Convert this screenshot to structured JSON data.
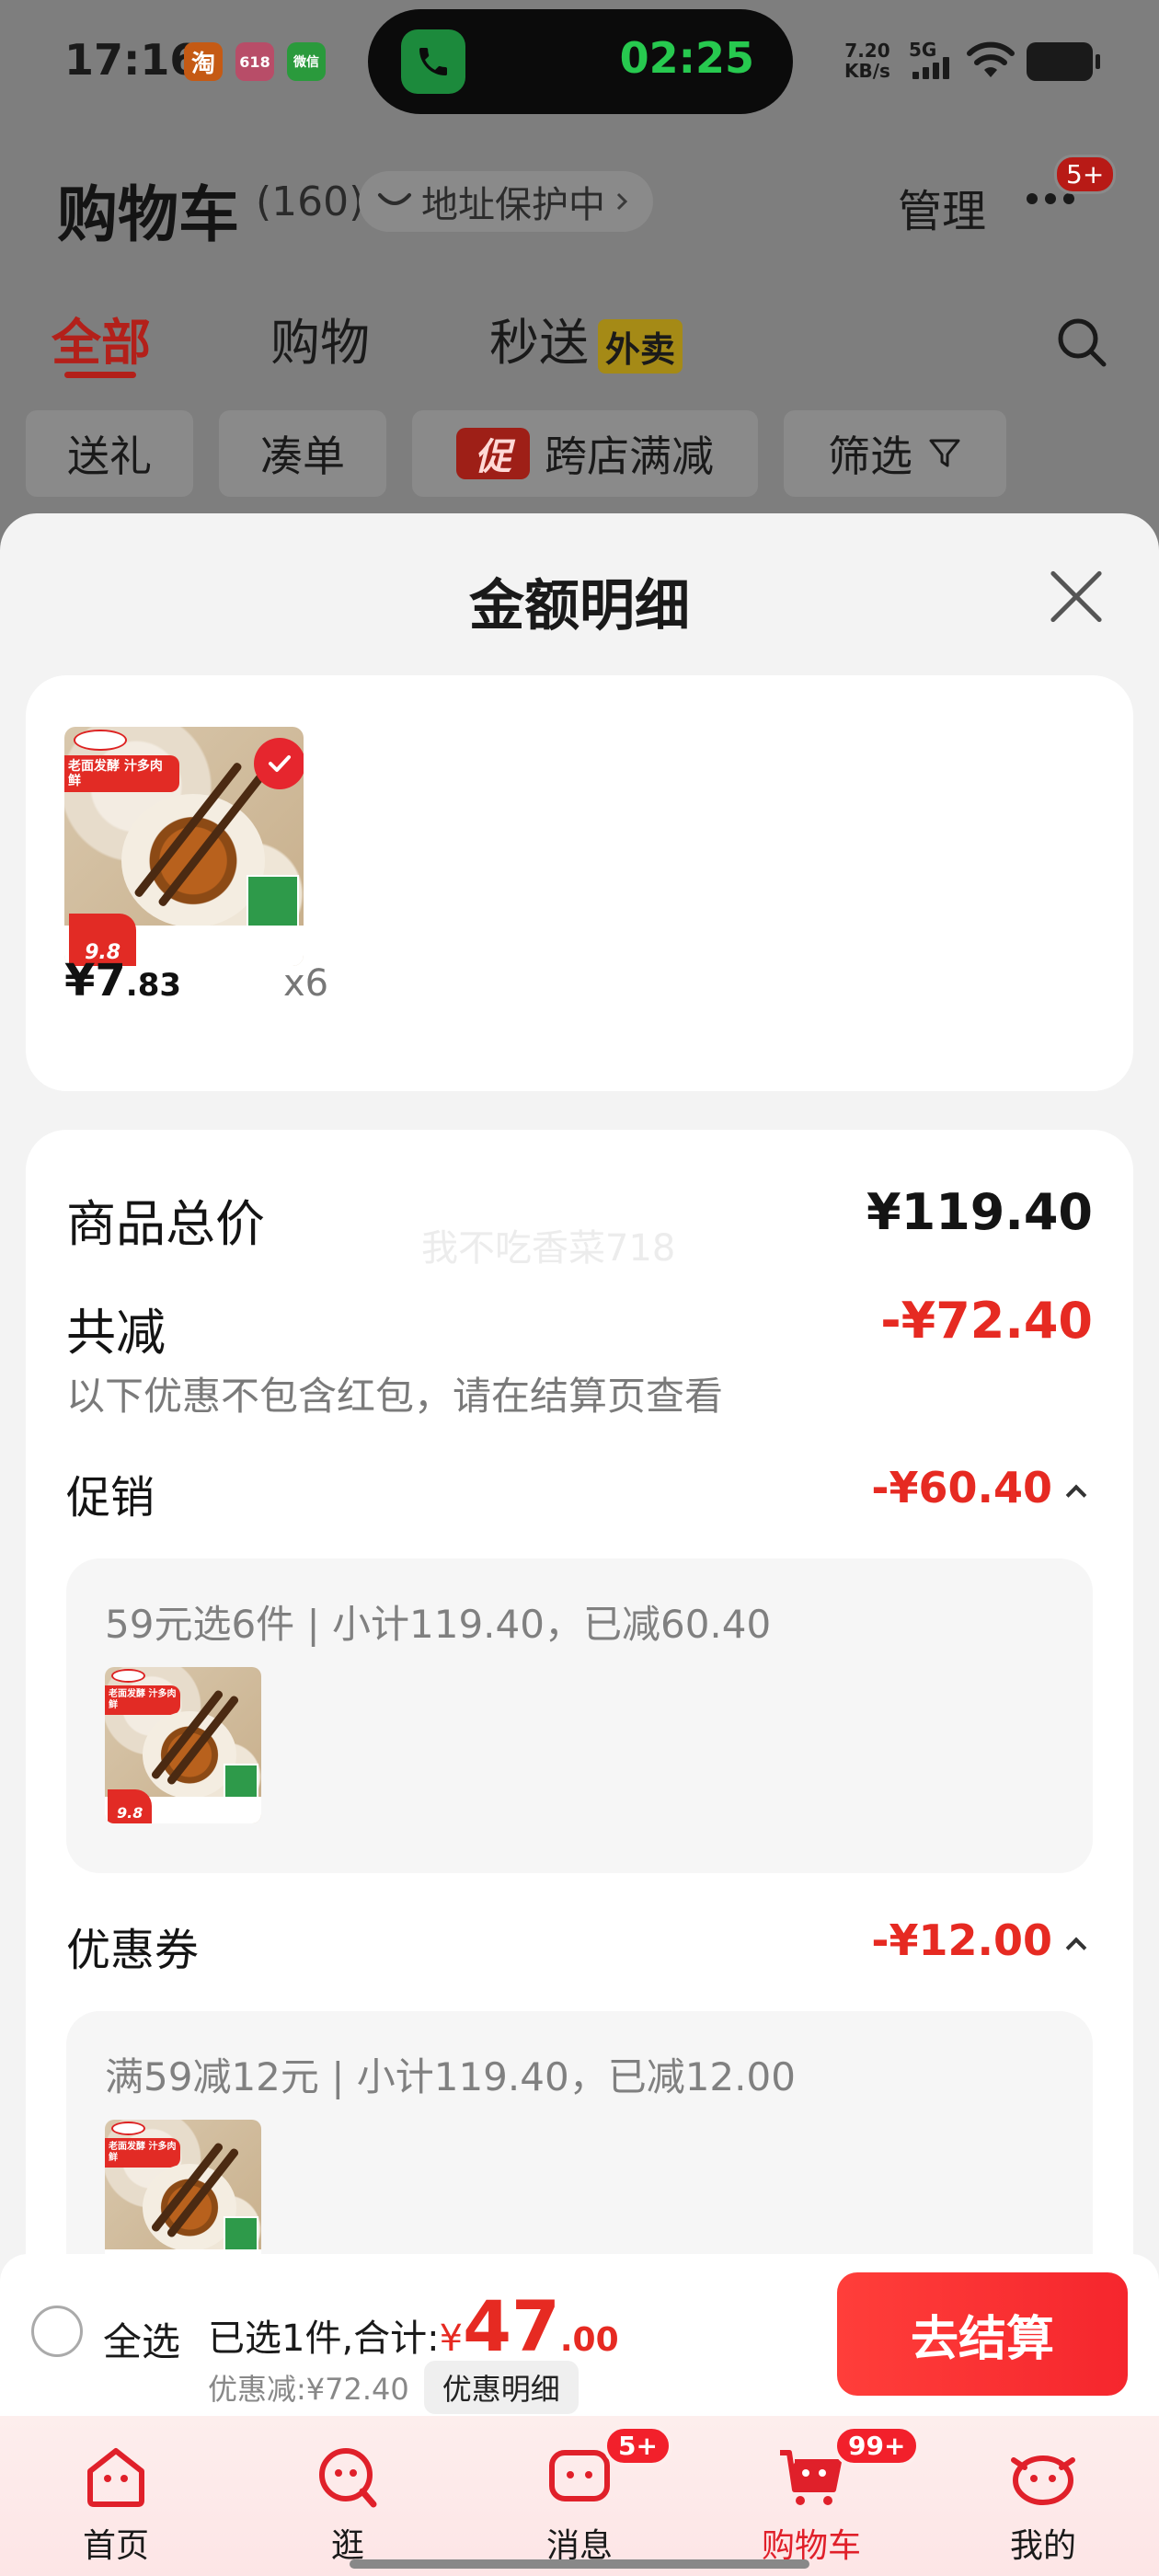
{
  "status_bar": {
    "time": "17:16",
    "apps": [
      "淘",
      "618",
      "微信"
    ],
    "call_timer": "02:25",
    "net_speed_value": "7.20",
    "net_speed_unit": "KB/s",
    "network": "5G"
  },
  "cart_header": {
    "title": "购物车",
    "count": "(160)",
    "address_protection": "地址保护中",
    "manage": "管理",
    "more_badge": "5+"
  },
  "cart_tabs": {
    "all": "全部",
    "shopping": "购物",
    "instant": "秒送",
    "waimai_tag": "外卖"
  },
  "filter_chips": {
    "gift": "送礼",
    "bundle": "凑单",
    "promo_tag": "促",
    "cross_store": "跨店满减",
    "filter": "筛选"
  },
  "sheet": {
    "title": "金额明细",
    "item": {
      "price_int": "¥7",
      "price_dec": ".83",
      "quantity": "x6",
      "thumb_tag": "老面发酵 汁多肉鲜",
      "thumb_price": "9.8"
    },
    "watermark": "我不吃香菜718",
    "total_label": "商品总价",
    "total_value": "¥119.40",
    "reduce_label": "共减",
    "reduce_value": "-¥72.40",
    "reduce_note": "以下优惠不包含红包，请在结算页查看",
    "promo_label": "促销",
    "promo_value": "-¥60.40",
    "promo_detail": "59元选6件 | 小计119.40，已减60.40",
    "coupon_label": "优惠券",
    "coupon_value": "-¥12.00",
    "coupon_detail": "满59减12元 | 小计119.40，已减12.00"
  },
  "checkout": {
    "select_all": "全选",
    "selected_prefix": "已选1件,合计:",
    "currency": "¥",
    "total_int": "47",
    "total_dec": ".00",
    "discount_text": "优惠减:¥72.40",
    "detail_chip": "优惠明细",
    "button": "去结算"
  },
  "tab_bar": {
    "home": "首页",
    "browse": "逛",
    "messages": "消息",
    "messages_badge": "5+",
    "cart": "购物车",
    "cart_badge": "99+",
    "me": "我的"
  },
  "colors": {
    "accent_red": "#e62a22",
    "checkout_red": "#f5262d",
    "dim_overlay": "#7f7f7f"
  }
}
